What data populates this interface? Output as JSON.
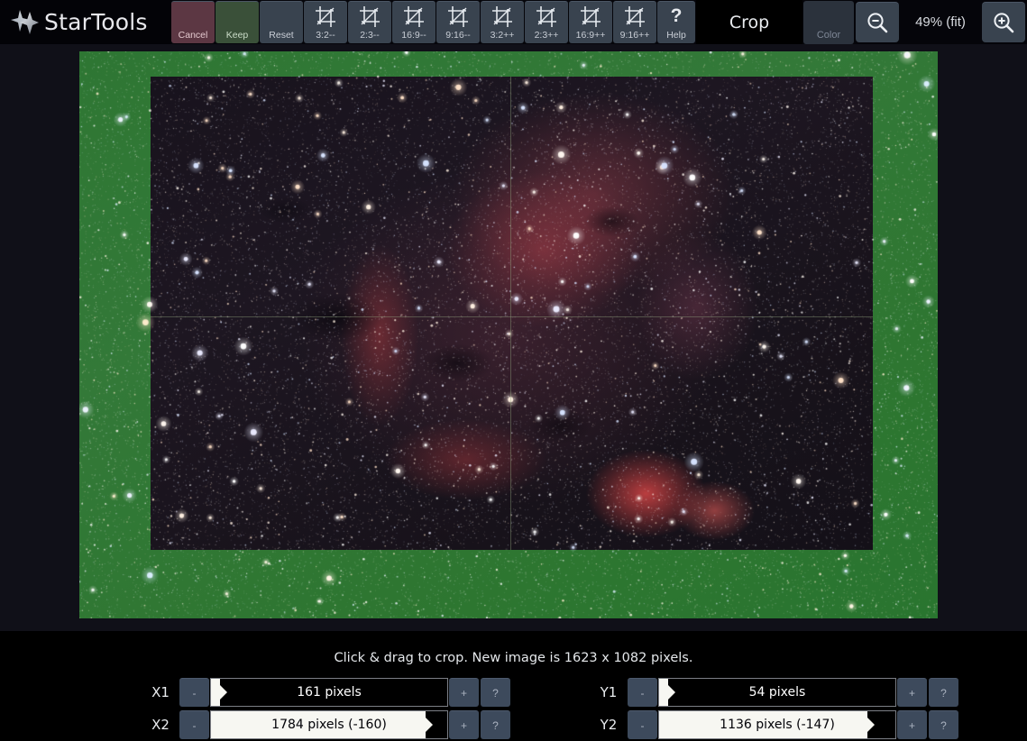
{
  "app": {
    "name": "StarTools",
    "logo_icon": "startools-star-logo"
  },
  "toolbar": {
    "buttons": [
      {
        "label": "Cancel",
        "icon": "",
        "kind": "cancel"
      },
      {
        "label": "Keep",
        "icon": "",
        "kind": "keep"
      },
      {
        "label": "Reset",
        "icon": "",
        "kind": "reset"
      },
      {
        "label": "3:2--",
        "icon": "crop-icon",
        "kind": "ratio"
      },
      {
        "label": "2:3--",
        "icon": "crop-icon",
        "kind": "ratio"
      },
      {
        "label": "16:9--",
        "icon": "crop-icon",
        "kind": "ratio"
      },
      {
        "label": "9:16--",
        "icon": "crop-icon",
        "kind": "ratio"
      },
      {
        "label": "3:2++",
        "icon": "crop-icon",
        "kind": "ratio"
      },
      {
        "label": "2:3++",
        "icon": "crop-icon",
        "kind": "ratio"
      },
      {
        "label": "16:9++",
        "icon": "crop-icon",
        "kind": "ratio"
      },
      {
        "label": "9:16++",
        "icon": "crop-icon",
        "kind": "ratio"
      },
      {
        "label": "Help",
        "icon": "question-mark-icon",
        "kind": "help"
      }
    ],
    "module_title": "Crop",
    "color_label": "Color",
    "zoom_out_icon": "magnifier-minus-icon",
    "zoom_in_icon": "magnifier-plus-icon",
    "zoom_level": "49% (fit)"
  },
  "status": {
    "message": "Click & drag to crop. New image is 1623 x 1082 pixels."
  },
  "controls": {
    "decrement_label": "-",
    "increment_label": "+",
    "help_label": "?",
    "rows": [
      {
        "axis": "X1",
        "value": "161 pixels",
        "fill_pct": 4
      },
      {
        "axis": "X2",
        "value": "1784 pixels (-160)",
        "fill_pct": 91
      },
      {
        "axis": "Y1",
        "value": "54 pixels",
        "fill_pct": 4
      },
      {
        "axis": "Y2",
        "value": "1136 pixels (-147)",
        "fill_pct": 88
      }
    ]
  },
  "colors": {
    "accent_green_overlay": "#229624",
    "cancel": "#5c3743",
    "keep": "#3a5039",
    "button": "#39434f",
    "canvas_bg": "#101018",
    "panel_bg": "#000000"
  }
}
